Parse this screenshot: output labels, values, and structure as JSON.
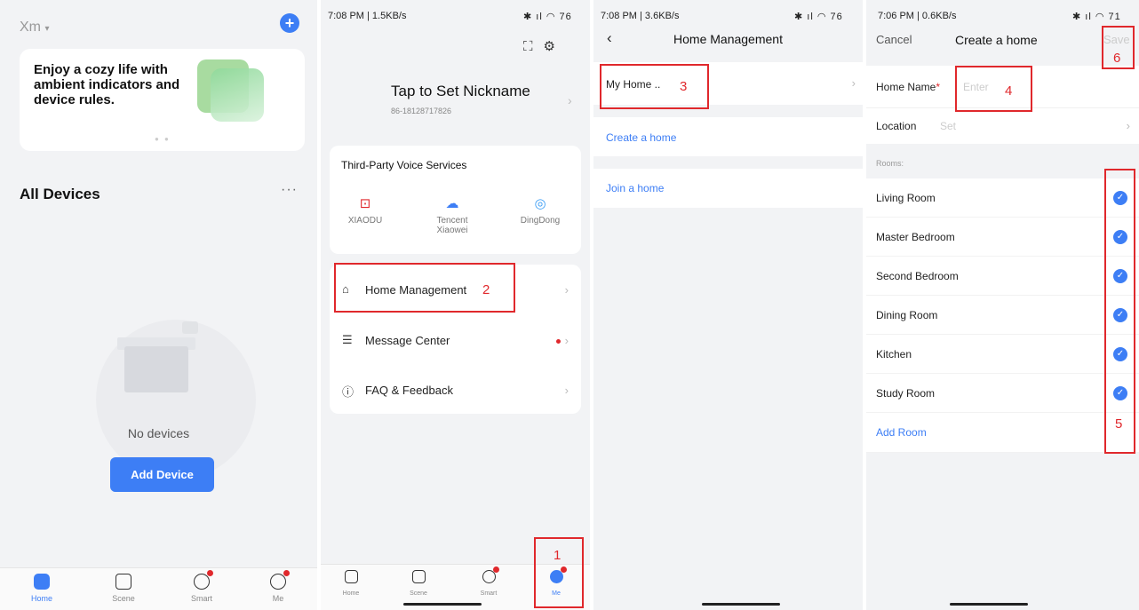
{
  "panel1": {
    "home_title": "Xm",
    "banner_text": "Enjoy a cozy life with ambient indicators and device rules.",
    "all_devices": "All Devices",
    "more": "···",
    "no_devices": "No devices",
    "add_device": "Add Device",
    "tabs": [
      "Home",
      "Scene",
      "Smart",
      "Me"
    ]
  },
  "panel2": {
    "status_left": "7:08 PM | 1.5KB/s",
    "status_right": "76",
    "nickname": "Tap to Set Nickname",
    "phone": "86-18128717826",
    "voice_title": "Third-Party Voice Services",
    "voice_services": [
      "XIAODU",
      "Tencent Xiaowei",
      "DingDong"
    ],
    "menu": [
      "Home Management",
      "Message Center",
      "FAQ & Feedback"
    ],
    "tabs": [
      "Home",
      "Scene",
      "Smart",
      "Me"
    ]
  },
  "panel3": {
    "status_left": "7:08 PM | 3.6KB/s",
    "status_right": "76",
    "title": "Home Management",
    "home_item": "My Home ..",
    "create_home": "Create a home",
    "join_home": "Join a home"
  },
  "panel4": {
    "status_left": "7:06 PM | 0.6KB/s",
    "status_right": "71",
    "cancel": "Cancel",
    "title": "Create a home",
    "save": "Save",
    "home_name_label": "Home Name",
    "home_name_placeholder": "Enter",
    "location_label": "Location",
    "location_value": "Set",
    "rooms_label": "Rooms:",
    "rooms": [
      "Living Room",
      "Master Bedroom",
      "Second Bedroom",
      "Dining Room",
      "Kitchen",
      "Study Room"
    ],
    "add_room": "Add Room"
  },
  "annotations": [
    "1",
    "2",
    "3",
    "4",
    "5",
    "6"
  ]
}
